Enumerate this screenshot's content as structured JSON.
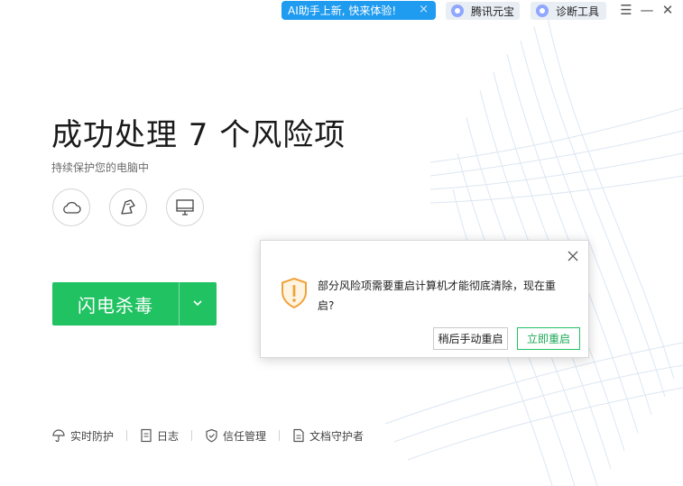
{
  "colors": {
    "accent_green": "#20c262",
    "ai_blue": "#1f9bf0",
    "warning_orange": "#f0a23a"
  },
  "topbar": {
    "ai_promo": "AI助手上新, 快来体验!",
    "ai_promo_close": "×",
    "chip_yuanbao": "腾讯元宝",
    "chip_diagnose": "诊断工具",
    "menu": "☰",
    "minimize": "—",
    "close": "✕"
  },
  "main": {
    "title": "成功处理 7 个风险项",
    "subtitle": "持续保护您的电脑中",
    "quick_icons": [
      "cloud-icon",
      "broom-icon",
      "monitor-icon"
    ],
    "scan_button": "闪电杀毒"
  },
  "bottom_bar": {
    "items": [
      "实时防护",
      "日志",
      "信任管理",
      "文档守护者"
    ]
  },
  "dialog": {
    "message": "部分风险项需要重启计算机才能彻底清除，现在重启?",
    "btn_later": "稍后手动重启",
    "btn_now": "立即重启"
  }
}
